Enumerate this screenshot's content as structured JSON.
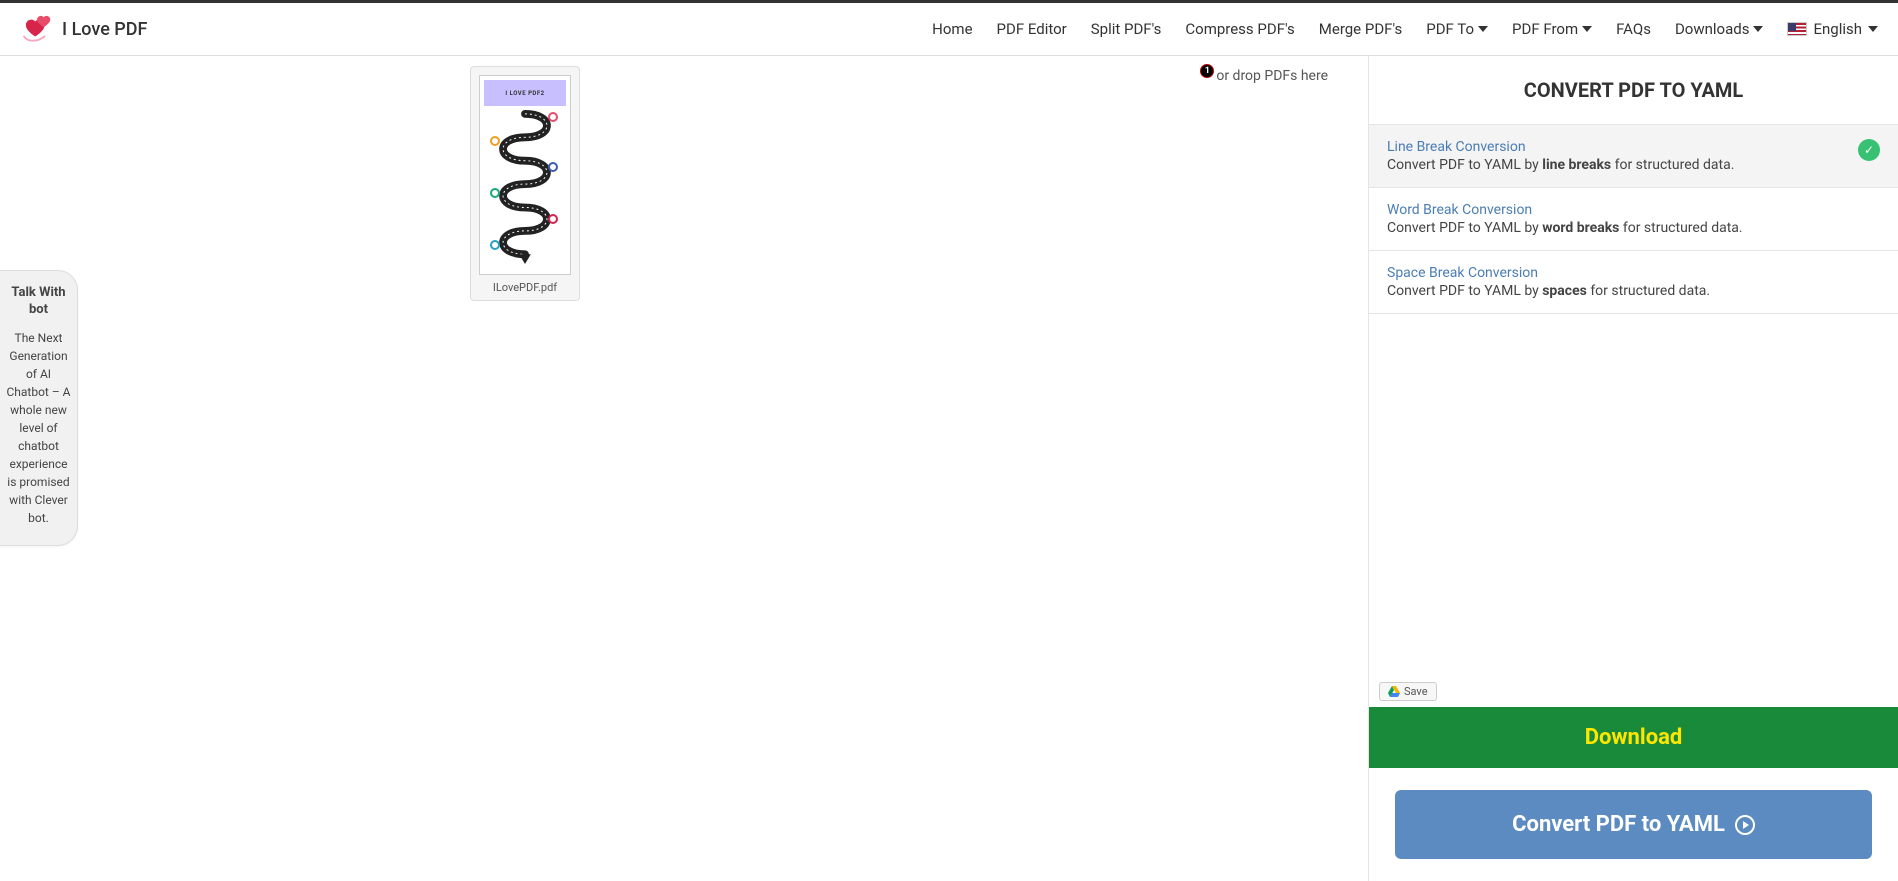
{
  "brand": {
    "name": "I Love PDF"
  },
  "nav": {
    "home": "Home",
    "pdf_editor": "PDF Editor",
    "split": "Split PDF's",
    "compress": "Compress PDF's",
    "merge": "Merge PDF's",
    "pdf_to": "PDF To",
    "pdf_from": "PDF From",
    "faqs": "FAQs",
    "downloads": "Downloads",
    "language": "English"
  },
  "workspace": {
    "drop_hint": "or drop PDFs here",
    "badge": "1",
    "file": {
      "name": "ILovePDF.pdf",
      "thumb_title": "I LOVE PDF2"
    }
  },
  "panel": {
    "title": "CONVERT PDF TO YAML",
    "options": [
      {
        "title": "Line Break Conversion",
        "desc_pre": "Convert PDF to YAML by ",
        "desc_bold": "line breaks",
        "desc_post": " for structured data.",
        "selected": true
      },
      {
        "title": "Word Break Conversion",
        "desc_pre": "Convert PDF to YAML by ",
        "desc_bold": "word breaks",
        "desc_post": " for structured data.",
        "selected": false
      },
      {
        "title": "Space Break Conversion",
        "desc_pre": "Convert PDF to YAML by ",
        "desc_bold": "spaces",
        "desc_post": " for structured data.",
        "selected": false
      }
    ],
    "save_label": "Save",
    "download_label": "Download",
    "convert_label": "Convert PDF to YAML"
  },
  "chatbot": {
    "title": "Talk With bot",
    "body": "The Next Generation of AI Chatbot – A whole new level of chatbot experience is promised with Clever bot."
  }
}
